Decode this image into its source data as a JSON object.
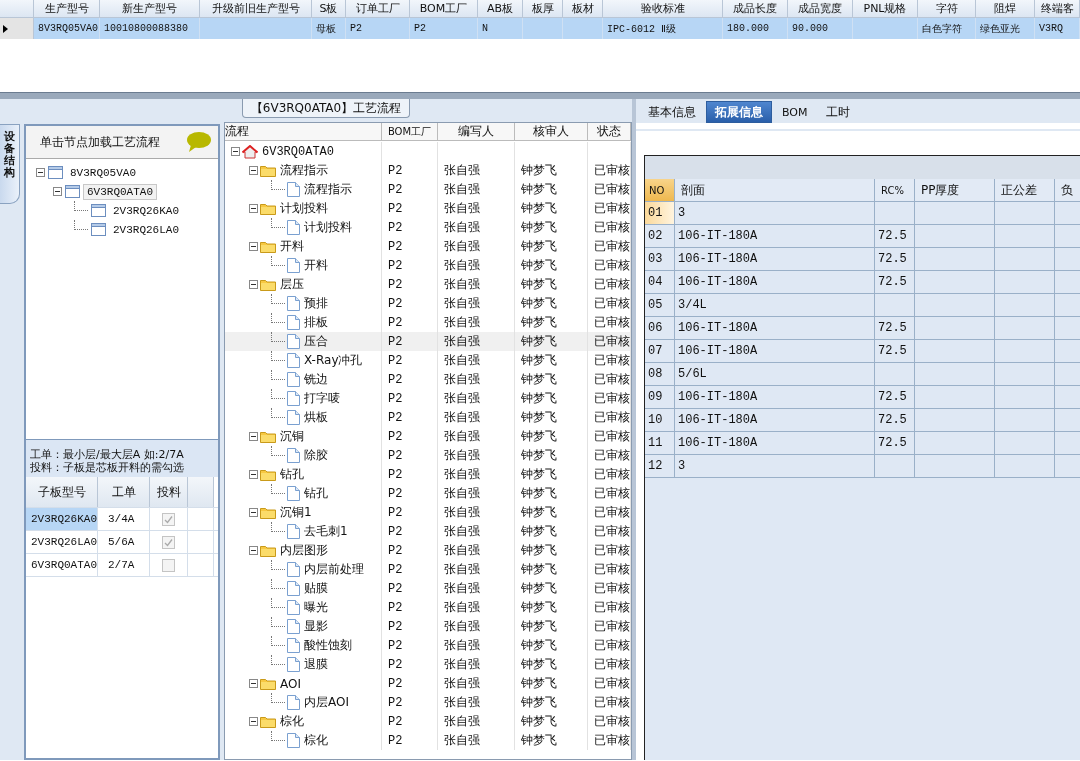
{
  "order_grid": {
    "columns": [
      "生产型号",
      "新生产型号",
      "升级前旧生产型号",
      "S板",
      "订单工厂",
      "BOM工厂",
      "AB板",
      "板厚",
      "板材",
      "验收标准",
      "成品长度",
      "成品宽度",
      "PNL规格",
      "字符",
      "阻焊",
      "终端客"
    ],
    "rows": [
      {
        "selected": true,
        "cells": [
          "8V3RQ05VA0",
          "10010800088380",
          null,
          "母板",
          "P2",
          "P2",
          "N",
          null,
          null,
          "IPC-6012 Ⅱ级",
          "180.000",
          "90.000",
          null,
          "白色字符",
          "绿色亚光",
          "V3RQ"
        ]
      }
    ]
  },
  "process_title": "【6V3RQ0ATA0】工艺流程",
  "side_tab": "设备结构",
  "structure": {
    "hint": "单击节点加载工艺流程",
    "tree": [
      {
        "label": "8V3RQ05VA0",
        "expanded": true,
        "selected": false,
        "children": [
          {
            "label": "6V3RQ0ATA0",
            "expanded": true,
            "selected": true,
            "children": [
              {
                "label": "2V3RQ26KA0",
                "selected": false
              },
              {
                "label": "2V3RQ26LA0",
                "selected": false
              }
            ]
          }
        ]
      }
    ],
    "notes": [
      "工单：最小层/最大层A 如:2/7A",
      "投料：子板是芯板开料的需勾选"
    ],
    "subboards": {
      "columns": [
        "子板型号",
        "工单",
        "投料"
      ],
      "rows": [
        {
          "cells": [
            "2V3RQ26KA0",
            "3/4A"
          ],
          "checked": true,
          "selected": true
        },
        {
          "cells": [
            "2V3RQ26LA0",
            "5/6A"
          ],
          "checked": true,
          "selected": false
        },
        {
          "cells": [
            "6V3RQ0ATA0",
            "2/7A"
          ],
          "checked": false,
          "selected": false
        }
      ]
    }
  },
  "process": {
    "columns": [
      "流程",
      "BOM工厂",
      "编写人",
      "核审人",
      "状态"
    ],
    "tree": [
      {
        "kind": "root",
        "label": "6V3RQ0ATA0",
        "expanded": true,
        "selected": false,
        "children": [
          {
            "kind": "folder",
            "label": "流程指示",
            "expanded": true,
            "selected": false,
            "cells": [
              "P2",
              "张自强",
              "钟梦飞",
              "已审核"
            ],
            "children": [
              {
                "kind": "step",
                "label": "流程指示",
                "selected": false,
                "cells": [
                  "P2",
                  "张自强",
                  "钟梦飞",
                  "已审核"
                ]
              }
            ]
          },
          {
            "kind": "folder",
            "label": "计划投料",
            "expanded": true,
            "selected": false,
            "cells": [
              "P2",
              "张自强",
              "钟梦飞",
              "已审核"
            ],
            "children": [
              {
                "kind": "step",
                "label": "计划投料",
                "selected": false,
                "cells": [
                  "P2",
                  "张自强",
                  "钟梦飞",
                  "已审核"
                ]
              }
            ]
          },
          {
            "kind": "folder",
            "label": "开料",
            "expanded": true,
            "selected": false,
            "cells": [
              "P2",
              "张自强",
              "钟梦飞",
              "已审核"
            ],
            "children": [
              {
                "kind": "step",
                "label": "开料",
                "selected": false,
                "cells": [
                  "P2",
                  "张自强",
                  "钟梦飞",
                  "已审核"
                ]
              }
            ]
          },
          {
            "kind": "folder",
            "label": "层压",
            "expanded": true,
            "selected": false,
            "cells": [
              "P2",
              "张自强",
              "钟梦飞",
              "已审核"
            ],
            "children": [
              {
                "kind": "step",
                "label": "预排",
                "selected": false,
                "cells": [
                  "P2",
                  "张自强",
                  "钟梦飞",
                  "已审核"
                ]
              },
              {
                "kind": "step",
                "label": "排板",
                "selected": false,
                "cells": [
                  "P2",
                  "张自强",
                  "钟梦飞",
                  "已审核"
                ]
              },
              {
                "kind": "step",
                "label": "压合",
                "selected": true,
                "cells": [
                  "P2",
                  "张自强",
                  "钟梦飞",
                  "已审核"
                ]
              },
              {
                "kind": "step",
                "label": "X-Ray冲孔",
                "selected": false,
                "cells": [
                  "P2",
                  "张自强",
                  "钟梦飞",
                  "已审核"
                ]
              },
              {
                "kind": "step",
                "label": "铣边",
                "selected": false,
                "cells": [
                  "P2",
                  "张自强",
                  "钟梦飞",
                  "已审核"
                ]
              },
              {
                "kind": "step",
                "label": "打字唛",
                "selected": false,
                "cells": [
                  "P2",
                  "张自强",
                  "钟梦飞",
                  "已审核"
                ]
              },
              {
                "kind": "step",
                "label": "烘板",
                "selected": false,
                "cells": [
                  "P2",
                  "张自强",
                  "钟梦飞",
                  "已审核"
                ]
              }
            ]
          },
          {
            "kind": "folder",
            "label": "沉铜",
            "expanded": true,
            "selected": false,
            "cells": [
              "P2",
              "张自强",
              "钟梦飞",
              "已审核"
            ],
            "children": [
              {
                "kind": "step",
                "label": "除胶",
                "selected": false,
                "cells": [
                  "P2",
                  "张自强",
                  "钟梦飞",
                  "已审核"
                ]
              }
            ]
          },
          {
            "kind": "folder",
            "label": "钻孔",
            "expanded": true,
            "selected": false,
            "cells": [
              "P2",
              "张自强",
              "钟梦飞",
              "已审核"
            ],
            "children": [
              {
                "kind": "step",
                "label": "钻孔",
                "selected": false,
                "cells": [
                  "P2",
                  "张自强",
                  "钟梦飞",
                  "已审核"
                ]
              }
            ]
          },
          {
            "kind": "folder",
            "label": "沉铜1",
            "expanded": true,
            "selected": false,
            "cells": [
              "P2",
              "张自强",
              "钟梦飞",
              "已审核"
            ],
            "children": [
              {
                "kind": "step",
                "label": "去毛刺1",
                "selected": false,
                "cells": [
                  "P2",
                  "张自强",
                  "钟梦飞",
                  "已审核"
                ]
              }
            ]
          },
          {
            "kind": "folder",
            "label": "内层图形",
            "expanded": true,
            "selected": false,
            "cells": [
              "P2",
              "张自强",
              "钟梦飞",
              "已审核"
            ],
            "children": [
              {
                "kind": "step",
                "label": "内层前处理",
                "selected": false,
                "cells": [
                  "P2",
                  "张自强",
                  "钟梦飞",
                  "已审核"
                ]
              },
              {
                "kind": "step",
                "label": "贴膜",
                "selected": false,
                "cells": [
                  "P2",
                  "张自强",
                  "钟梦飞",
                  "已审核"
                ]
              },
              {
                "kind": "step",
                "label": "曝光",
                "selected": false,
                "cells": [
                  "P2",
                  "张自强",
                  "钟梦飞",
                  "已审核"
                ]
              },
              {
                "kind": "step",
                "label": "显影",
                "selected": false,
                "cells": [
                  "P2",
                  "张自强",
                  "钟梦飞",
                  "已审核"
                ]
              },
              {
                "kind": "step",
                "label": "酸性蚀刻",
                "selected": false,
                "cells": [
                  "P2",
                  "张自强",
                  "钟梦飞",
                  "已审核"
                ]
              },
              {
                "kind": "step",
                "label": "退膜",
                "selected": false,
                "cells": [
                  "P2",
                  "张自强",
                  "钟梦飞",
                  "已审核"
                ]
              }
            ]
          },
          {
            "kind": "folder",
            "label": "AOI",
            "expanded": true,
            "selected": false,
            "cells": [
              "P2",
              "张自强",
              "钟梦飞",
              "已审核"
            ],
            "children": [
              {
                "kind": "step",
                "label": "内层AOI",
                "selected": false,
                "cells": [
                  "P2",
                  "张自强",
                  "钟梦飞",
                  "已审核"
                ]
              }
            ]
          },
          {
            "kind": "folder",
            "label": "棕化",
            "expanded": true,
            "selected": false,
            "cells": [
              "P2",
              "张自强",
              "钟梦飞",
              "已审核"
            ],
            "children": [
              {
                "kind": "step",
                "label": "棕化",
                "selected": false,
                "cells": [
                  "P2",
                  "张自强",
                  "钟梦飞",
                  "已审核"
                ]
              }
            ]
          }
        ]
      }
    ]
  },
  "detail_tabs": [
    {
      "label": "基本信息",
      "selected": false
    },
    {
      "label": "拓展信息",
      "selected": true
    },
    {
      "label": "BOM",
      "selected": false
    },
    {
      "label": "工时",
      "selected": false
    }
  ],
  "stackup": {
    "columns": [
      "NO",
      "剖面",
      "RC%",
      "PP厚度",
      "正公差",
      "负"
    ],
    "rows": [
      {
        "no": "01",
        "section": "3",
        "rc": null,
        "selected": true
      },
      {
        "no": "02",
        "section": "106-IT-180A",
        "rc": "72.5",
        "selected": false
      },
      {
        "no": "03",
        "section": "106-IT-180A",
        "rc": "72.5",
        "selected": false
      },
      {
        "no": "04",
        "section": "106-IT-180A",
        "rc": "72.5",
        "selected": false
      },
      {
        "no": "05",
        "section": "3/4L",
        "rc": null,
        "selected": false
      },
      {
        "no": "06",
        "section": "106-IT-180A",
        "rc": "72.5",
        "selected": false
      },
      {
        "no": "07",
        "section": "106-IT-180A",
        "rc": "72.5",
        "selected": false
      },
      {
        "no": "08",
        "section": "5/6L",
        "rc": null,
        "selected": false
      },
      {
        "no": "09",
        "section": "106-IT-180A",
        "rc": "72.5",
        "selected": false
      },
      {
        "no": "10",
        "section": "106-IT-180A",
        "rc": "72.5",
        "selected": false
      },
      {
        "no": "11",
        "section": "106-IT-180A",
        "rc": "72.5",
        "selected": false
      },
      {
        "no": "12",
        "section": "3",
        "rc": null,
        "selected": false
      }
    ]
  }
}
